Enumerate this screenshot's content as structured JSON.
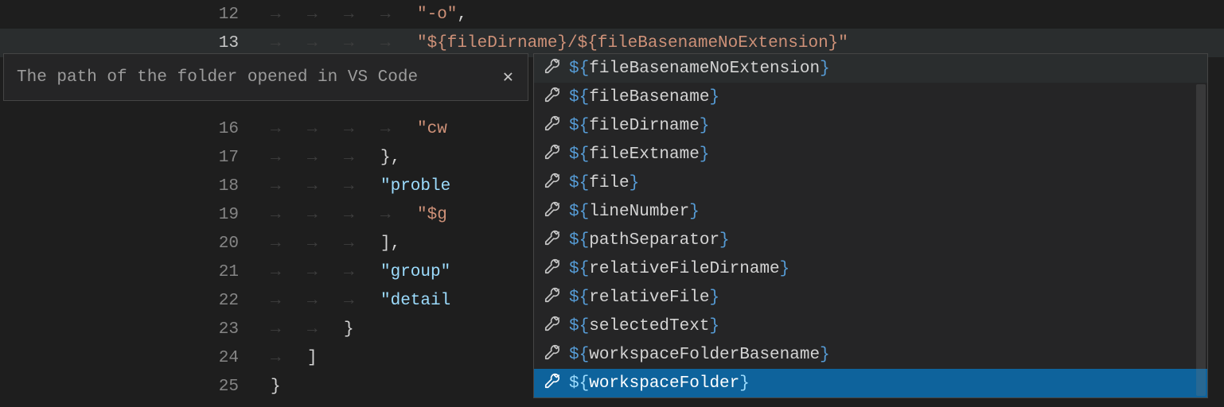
{
  "colors": {
    "background": "#1e1e1e",
    "selectedBg": "#0e639c",
    "string": "#ce9178",
    "variable": "#569cd6"
  },
  "tooltip": {
    "text": "The path of the folder opened in VS Code"
  },
  "lines": [
    {
      "num": "12",
      "indent": 4,
      "kind": "string",
      "text": "\"-o\"",
      "trail": ","
    },
    {
      "num": "13",
      "indent": 4,
      "kind": "string",
      "text": "\"${fileDirname}/${fileBasenameNoExtension}\"",
      "current": true
    },
    {
      "num": "",
      "indent": 0,
      "kind": "blank",
      "text": ""
    },
    {
      "num": "",
      "indent": 0,
      "kind": "blank",
      "text": ""
    },
    {
      "num": "16",
      "indent": 4,
      "kind": "string",
      "text": "\"cw"
    },
    {
      "num": "17",
      "indent": 3,
      "kind": "punct",
      "text": "},"
    },
    {
      "num": "18",
      "indent": 3,
      "kind": "key",
      "text": "\"proble"
    },
    {
      "num": "19",
      "indent": 4,
      "kind": "string",
      "text": "\"$g"
    },
    {
      "num": "20",
      "indent": 3,
      "kind": "punct",
      "text": "],"
    },
    {
      "num": "21",
      "indent": 3,
      "kind": "key",
      "text": "\"group\""
    },
    {
      "num": "22",
      "indent": 3,
      "kind": "key",
      "text": "\"detail"
    },
    {
      "num": "23",
      "indent": 2,
      "kind": "punct",
      "text": "}"
    },
    {
      "num": "24",
      "indent": 1,
      "kind": "punct",
      "text": "]"
    },
    {
      "num": "25",
      "indent": 0,
      "kind": "punct",
      "text": "}"
    }
  ],
  "suggestions": [
    {
      "label": "fileBasenameNoExtension",
      "focused": true
    },
    {
      "label": "fileBasename"
    },
    {
      "label": "fileDirname"
    },
    {
      "label": "fileExtname"
    },
    {
      "label": "file"
    },
    {
      "label": "lineNumber"
    },
    {
      "label": "pathSeparator"
    },
    {
      "label": "relativeFileDirname"
    },
    {
      "label": "relativeFile"
    },
    {
      "label": "selectedText"
    },
    {
      "label": "workspaceFolderBasename"
    },
    {
      "label": "workspaceFolder",
      "selected": true
    }
  ]
}
